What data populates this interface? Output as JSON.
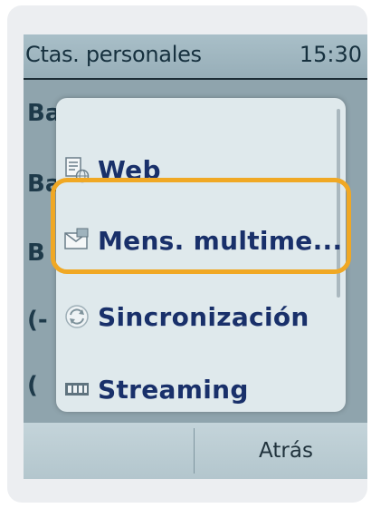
{
  "status_bar": {
    "title": "Ctas. personales",
    "time": "15:30"
  },
  "background_list": {
    "rows": [
      "Ba",
      "Ba",
      "B",
      "(-",
      "("
    ]
  },
  "menu": {
    "items": [
      {
        "label": "Web",
        "icon": "web-page-icon"
      },
      {
        "label": "Mens. multime...",
        "icon": "multimedia-message-icon"
      },
      {
        "label": "Sincronización",
        "icon": "sync-icon"
      },
      {
        "label": "Streaming",
        "icon": "streaming-icon"
      }
    ]
  },
  "softkeys": {
    "left": "",
    "right": "Atrás"
  },
  "colors": {
    "highlight": "#f0a824",
    "menu_text": "#19306a",
    "screen_bg": "#8fa4ad"
  }
}
